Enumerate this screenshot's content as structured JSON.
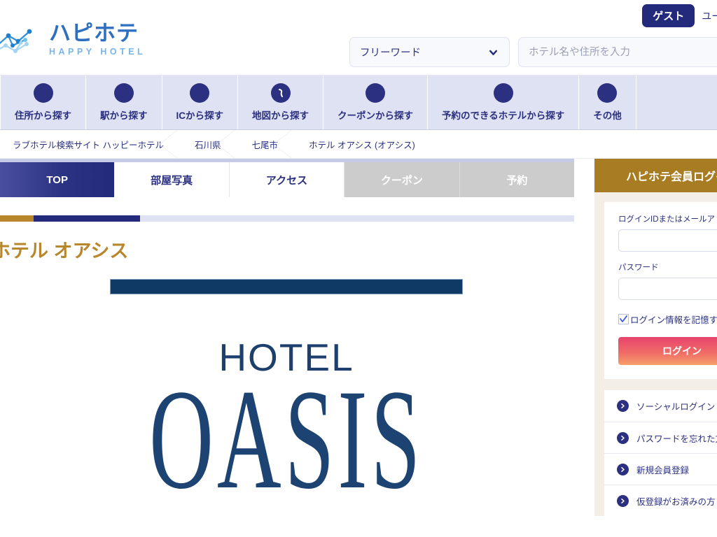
{
  "header": {
    "logo_jp": "ハピホテ",
    "logo_en": "HAPPY HOTEL",
    "guest_badge": "ゲスト",
    "guest_user": "ユーザー",
    "search_category": "フリーワード",
    "search_placeholder": "ホテル名や住所を入力",
    "search_value": ""
  },
  "nav": {
    "items": [
      {
        "label": "住所から探す",
        "icon": "pin-icon"
      },
      {
        "label": "駅から探す",
        "icon": "train-icon"
      },
      {
        "label": "ICから探す",
        "icon": "highway-icon"
      },
      {
        "label": "地図から探す",
        "icon": "map-icon"
      },
      {
        "label": "クーポンから探す",
        "icon": "coupon-icon"
      },
      {
        "label": "予約のできるホテルから探す",
        "icon": "calendar-icon"
      },
      {
        "label": "その他",
        "icon": "more-icon"
      }
    ]
  },
  "breadcrumb": {
    "items": [
      "ラブホテル検索サイト ハッピーホテル",
      "石川県",
      "七尾市",
      "ホテル オアシス (オアシス)"
    ]
  },
  "tabs": [
    {
      "label": "TOP",
      "state": "active"
    },
    {
      "label": "部屋写真",
      "state": "plain"
    },
    {
      "label": "アクセス",
      "state": "plain"
    },
    {
      "label": "クーポン",
      "state": "disabled"
    },
    {
      "label": "予約",
      "state": "disabled"
    }
  ],
  "main": {
    "hotel_title": "ホテル オアシス",
    "hero_logo_top": "HOTEL",
    "hero_logo_bottom": "OASIS"
  },
  "login": {
    "panel_title": "ハピホテ会員ログイン",
    "id_label": "ログインIDまたはメールアドレス",
    "id_value": "",
    "password_label": "パスワード",
    "password_value": "",
    "remember_label": "ログイン情報を記憶する",
    "remember_checked": true,
    "login_button": "ログイン",
    "links": [
      "ソーシャルログイン",
      "パスワードを忘れた方",
      "新規会員登録",
      "仮登録がお済みの方"
    ]
  },
  "colors": {
    "navy": "#2b3080",
    "gold": "#b8862b",
    "panel_gold": "#a87c22",
    "nav_bg": "#dfe2f2",
    "login_pink": "#e8446e",
    "login_orange": "#f5a06a",
    "hero_navy": "#103a66",
    "logo_blue": "#2f6fc0"
  }
}
